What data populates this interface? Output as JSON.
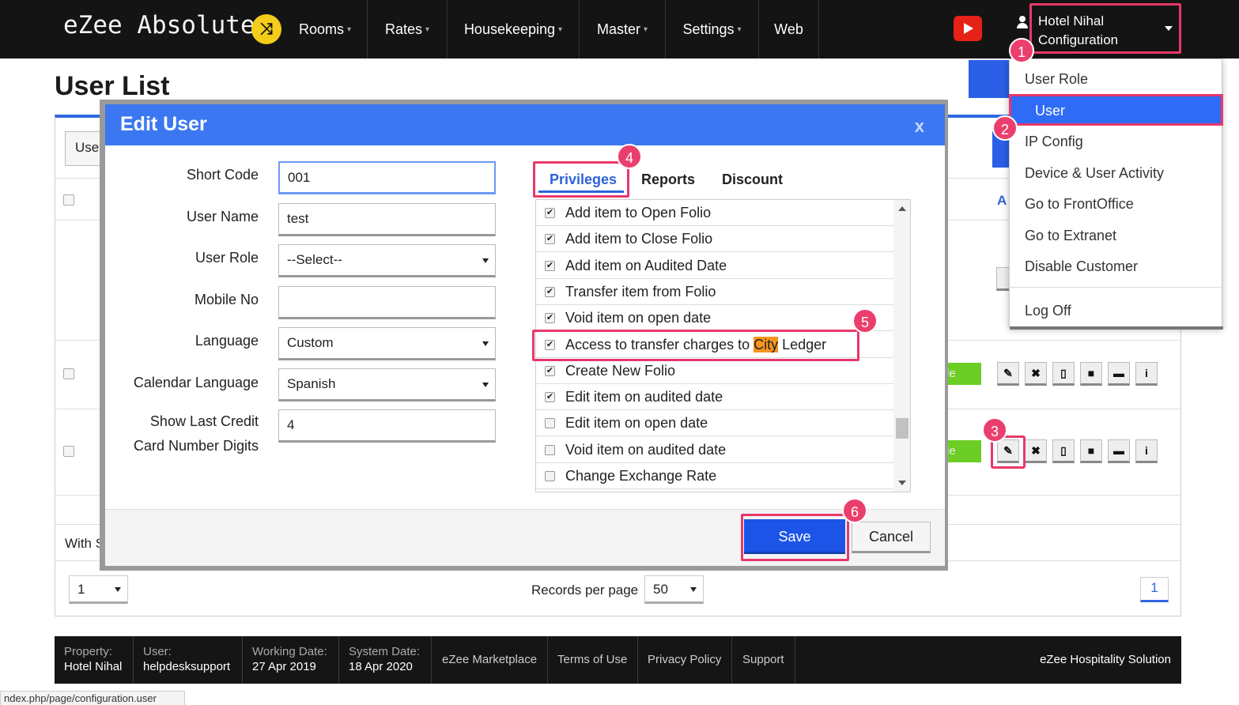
{
  "app": {
    "logo": "eZee Absolute",
    "logo_badge": "⤨"
  },
  "nav": [
    {
      "label": "Rooms",
      "caret": "▾"
    },
    {
      "label": "Rates",
      "caret": "▾"
    },
    {
      "label": "Housekeeping",
      "caret": "▾"
    },
    {
      "label": "Master",
      "caret": "▾"
    },
    {
      "label": "Settings",
      "caret": "▾"
    },
    {
      "label": "Web",
      "caret": ""
    }
  ],
  "user_menu": {
    "line1": "Hotel Nihal",
    "line2": "Configuration"
  },
  "dropdown": {
    "items": [
      "User Role",
      "User",
      "IP Config",
      "Device & User Activity",
      "Go to FrontOffice",
      "Go to Extranet",
      "Disable Customer",
      "Log Off"
    ]
  },
  "page": {
    "title": "User List",
    "use_button": "Use",
    "with_text": "With S",
    "status_1": "le",
    "status_2": "le",
    "col_a": "A"
  },
  "icons": {
    "edit": "✎",
    "delete": "✖",
    "calc": "▯",
    "lock": "■",
    "chat": "▬",
    "info": "i"
  },
  "pagination": {
    "page_select": "1",
    "records_label": "Records per page",
    "records_value": "50",
    "current_page": "1"
  },
  "modal": {
    "title": "Edit User",
    "close": "x",
    "fields": [
      {
        "label": "Short Code",
        "value": "001"
      },
      {
        "label": "User Name",
        "value": "test"
      },
      {
        "label": "User Role",
        "value": "--Select--"
      },
      {
        "label": "Mobile No",
        "value": ""
      },
      {
        "label": "Language",
        "value": "Custom"
      },
      {
        "label": "Calendar Language",
        "value": "Spanish"
      },
      {
        "label": "Show Last Credit Card Number Digits",
        "label_line1": "Show Last Credit",
        "label_line2": "Card Number Digits",
        "value": "4"
      }
    ],
    "tabs": [
      "Privileges",
      "Reports",
      "Discount"
    ],
    "privileges": [
      {
        "label": "Add item to Open Folio",
        "checked": true
      },
      {
        "label": "Add item to Close Folio",
        "checked": true
      },
      {
        "label": "Add item on Audited Date",
        "checked": true
      },
      {
        "label": "Transfer item from Folio",
        "checked": true
      },
      {
        "label": "Void item on open date",
        "checked": true
      },
      {
        "label_pre": "Access to transfer charges to ",
        "label_hl": "City",
        "label_post": " Ledger",
        "checked": true
      },
      {
        "label": "Create New Folio",
        "checked": true
      },
      {
        "label": "Edit item on audited date",
        "checked": true
      },
      {
        "label": "Edit item on open date",
        "checked": false
      },
      {
        "label": "Void item on audited date",
        "checked": false
      },
      {
        "label": "Change Exchange Rate",
        "checked": false
      }
    ],
    "save": "Save",
    "cancel": "Cancel"
  },
  "steps": [
    "1",
    "2",
    "3",
    "4",
    "5",
    "6"
  ],
  "footer": {
    "property_label": "Property:",
    "property_value": "Hotel Nihal",
    "user_label": "User:",
    "user_value": "helpdesksupport",
    "working_label": "Working Date:",
    "working_value": "27 Apr 2019",
    "system_label": "System Date:",
    "system_value": "18 Apr 2020",
    "links": [
      "eZee Marketplace",
      "Terms of Use",
      "Privacy Policy",
      "Support"
    ],
    "brand": "eZee Hospitality Solution"
  },
  "status_url": "ndex.php/page/configuration.user",
  "colors": {
    "header_blue": "#3b77f0",
    "highlight": "#e8386a",
    "topbar": "#141414"
  }
}
